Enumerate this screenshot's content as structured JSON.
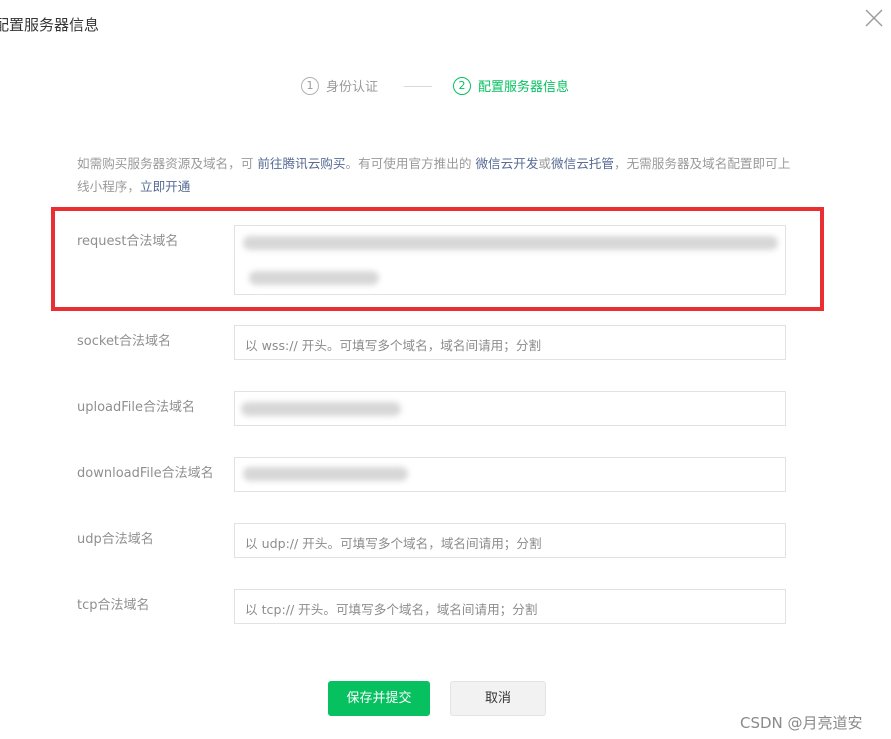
{
  "dialog": {
    "title": "配置服务器信息",
    "close_icon": "close-icon"
  },
  "steps": [
    {
      "num": "1",
      "label": "身份认证"
    },
    {
      "num": "2",
      "label": "配置服务器信息"
    }
  ],
  "tip": {
    "text_1": "如需购买服务器资源及域名，可 ",
    "link_buy": "前往腾讯云购买",
    "text_2": "。有可使用官方推出的 ",
    "link_cloud_dev": "微信云开发",
    "text_3": "或",
    "link_cloud_host": "微信云托管",
    "text_4": "，无需服务器及域名配置即可上线小程序，",
    "link_open": "立即开通"
  },
  "form": {
    "request": {
      "label": "request合法域名",
      "value": "",
      "placeholder": ""
    },
    "socket": {
      "label": "socket合法域名",
      "placeholder": "以 wss:// 开头。可填写多个域名，域名间请用；分割"
    },
    "uploadFile": {
      "label": "uploadFile合法域名",
      "value": ""
    },
    "downloadFile": {
      "label": "downloadFile合法域名",
      "value": ""
    },
    "udp": {
      "label": "udp合法域名",
      "placeholder": "以 udp:// 开头。可填写多个域名，域名间请用；分割"
    },
    "tcp": {
      "label": "tcp合法域名",
      "placeholder": "以 tcp:// 开头。可填写多个域名，域名间请用；分割"
    }
  },
  "buttons": {
    "submit": "保存并提交",
    "cancel": "取消"
  },
  "watermark": "CSDN @月亮道安",
  "colors": {
    "accent": "#07c160",
    "link": "#576b95",
    "highlight": "#e92f31"
  }
}
